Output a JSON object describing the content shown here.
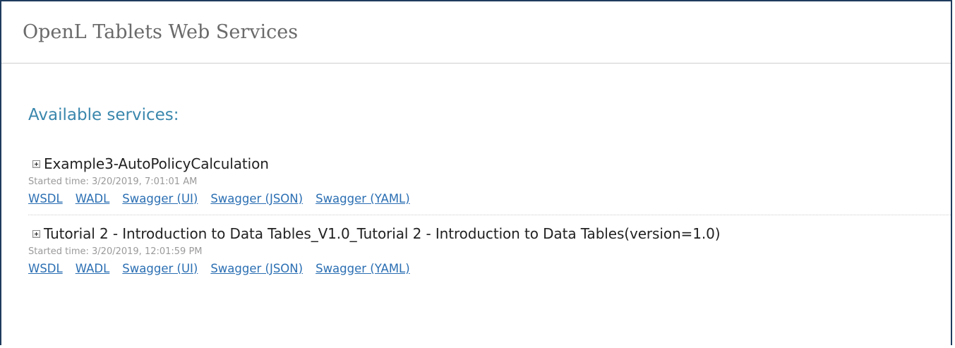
{
  "header": {
    "title": "OpenL Tablets Web Services"
  },
  "main": {
    "heading": "Available services:",
    "services": [
      {
        "name": "Example3-AutoPolicyCalculation",
        "started": "Started time: 3/20/2019, 7:01:01 AM",
        "links": [
          "WSDL",
          "WADL",
          "Swagger (UI)",
          "Swagger (JSON)",
          "Swagger (YAML)"
        ]
      },
      {
        "name": "Tutorial 2 - Introduction to Data Tables_V1.0_Tutorial 2 - Introduction to Data Tables(version=1.0)",
        "started": "Started time: 3/20/2019, 12:01:59 PM",
        "links": [
          "WSDL",
          "WADL",
          "Swagger (UI)",
          "Swagger (JSON)",
          "Swagger (YAML)"
        ]
      }
    ]
  },
  "icons": {
    "expand": "expand-plus-icon"
  },
  "colors": {
    "heading": "#3a87ad",
    "link": "#2b6fb3",
    "frame": "#1f3b5e",
    "muted": "#9a9a9a"
  }
}
